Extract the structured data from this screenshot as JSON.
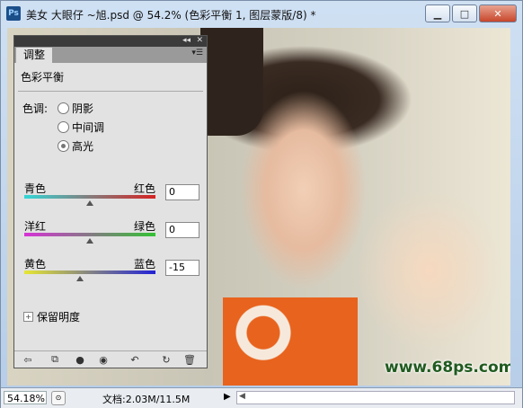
{
  "window": {
    "app_icon": "Ps",
    "title": "美女 大眼仔 ~旭.psd @ 54.2% (色彩平衡 1, 图层蒙版/8) *",
    "buttons": {
      "minimize": "▁",
      "maximize": "□",
      "close": "✕"
    }
  },
  "panel": {
    "tab": "调整",
    "title": "色彩平衡",
    "tone_label": "色调:",
    "tones": [
      {
        "label": "阴影",
        "selected": false
      },
      {
        "label": "中间调",
        "selected": false
      },
      {
        "label": "高光",
        "selected": true
      }
    ],
    "sliders": [
      {
        "left": "青色",
        "right": "红色",
        "value": "0",
        "level": 0,
        "gradient": [
          "#33d6d6",
          "#d62222"
        ]
      },
      {
        "left": "洋红",
        "right": "绿色",
        "value": "0",
        "level": 0,
        "gradient": [
          "#d632d6",
          "#33c233"
        ]
      },
      {
        "left": "黄色",
        "right": "蓝色",
        "value": "-15",
        "level": -15,
        "gradient": [
          "#e6e633",
          "#2222d6"
        ]
      }
    ],
    "preserve_luminosity": "保留明度",
    "toolbar_icons": [
      "back-arrow-icon",
      "clip-layer-icon",
      "mask-icon",
      "eye-icon",
      "previous-state-icon",
      "reset-icon",
      "trash-icon"
    ]
  },
  "watermark": "www.68ps.com",
  "status": {
    "zoom": "54.18%",
    "doc": "文档:2.03M/11.5M",
    "arrow": "▶",
    "scroll_left": "◀"
  }
}
